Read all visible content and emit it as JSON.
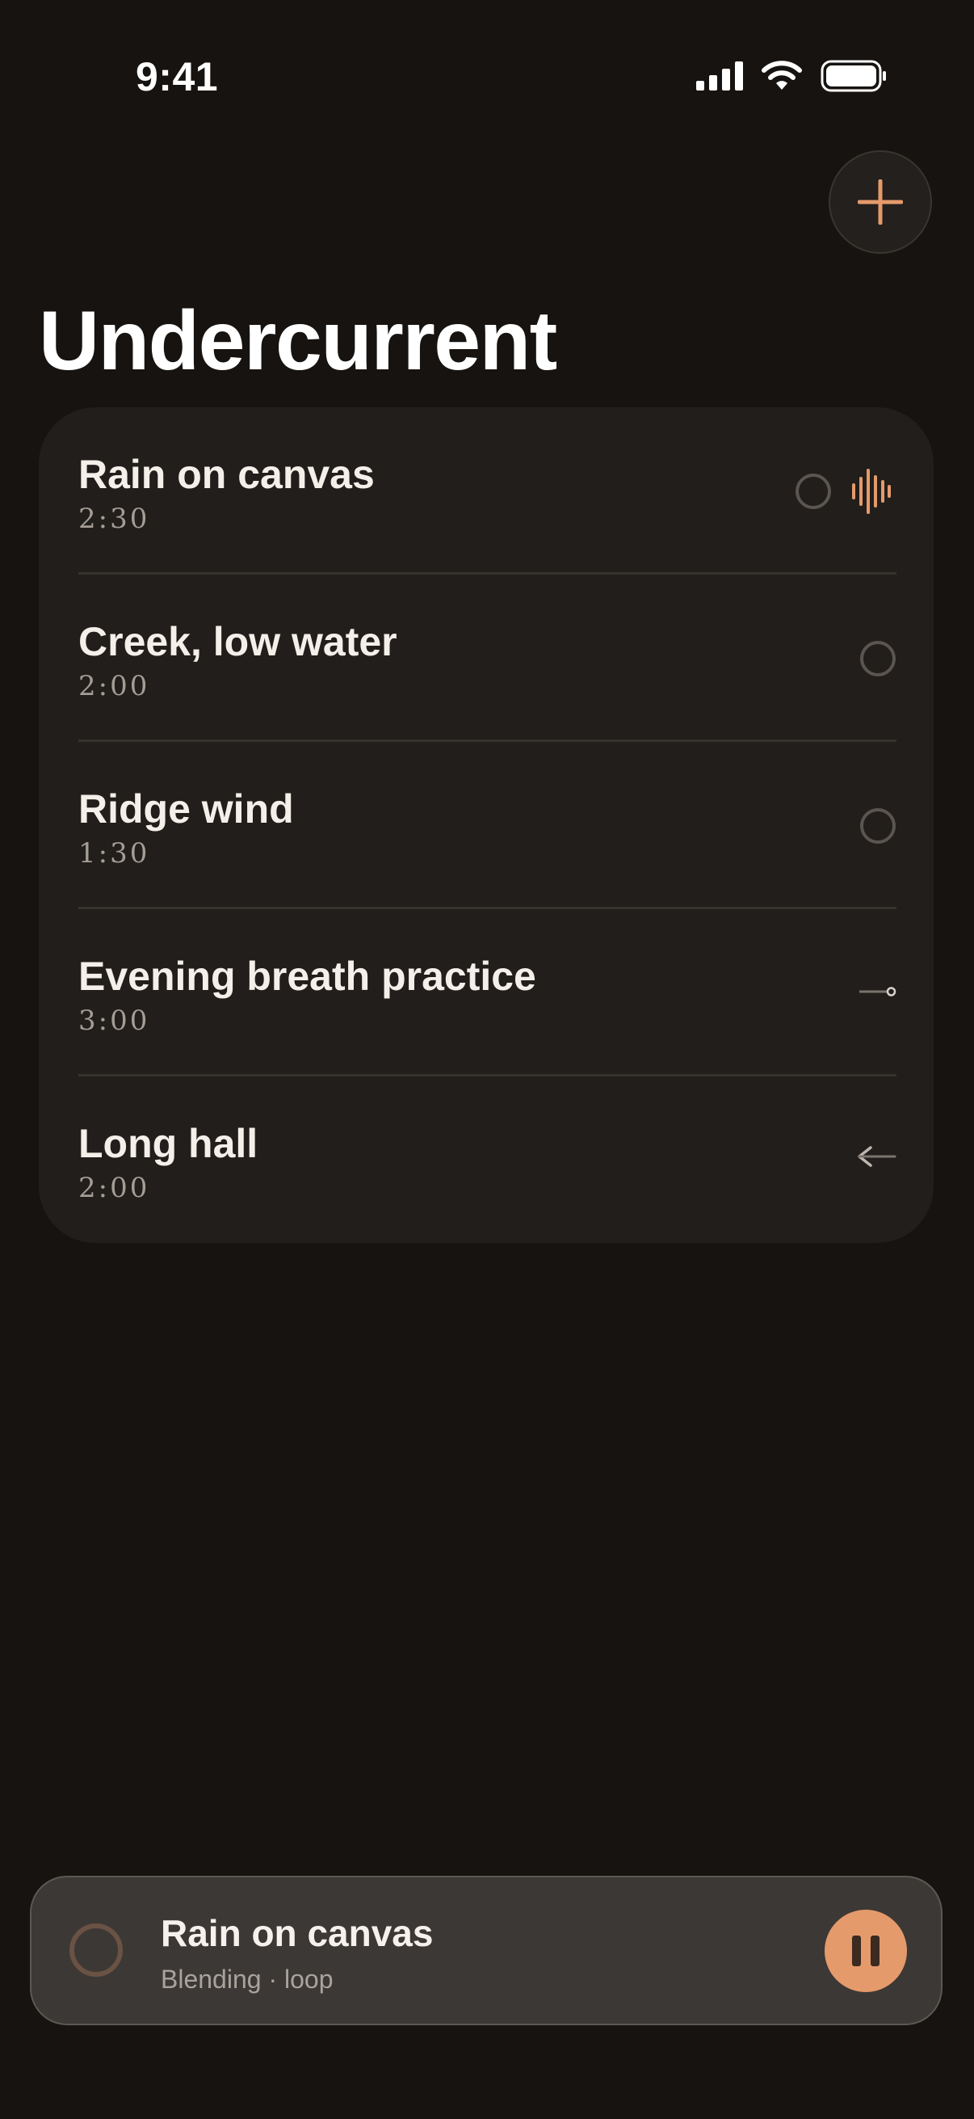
{
  "status_bar": {
    "time": "9:41"
  },
  "header": {
    "title": "Undercurrent",
    "add_icon": "plus-icon"
  },
  "colors": {
    "background": "#161310",
    "card": "#211e1b",
    "accent": "#e59a6b",
    "now_playing_bg": "#3c3835"
  },
  "sounds": [
    {
      "title": "Rain on canvas",
      "duration": "2:30",
      "status": "playing",
      "icons": [
        "status-ring-icon",
        "waveform-icon"
      ]
    },
    {
      "title": "Creek, low water",
      "duration": "2:00",
      "status": "idle",
      "icons": [
        "status-ring-icon"
      ]
    },
    {
      "title": "Ridge wind",
      "duration": "1:30",
      "status": "idle",
      "icons": [
        "status-ring-icon"
      ]
    },
    {
      "title": "Evening breath practice",
      "duration": "3:00",
      "status": "linked",
      "icons": [
        "line-dot-icon"
      ]
    },
    {
      "title": "Long hall",
      "duration": "2:00",
      "status": "back",
      "icons": [
        "arrow-left-icon"
      ]
    }
  ],
  "now_playing": {
    "title": "Rain on canvas",
    "subtitle": "Blending · loop",
    "control": "pause-icon"
  }
}
